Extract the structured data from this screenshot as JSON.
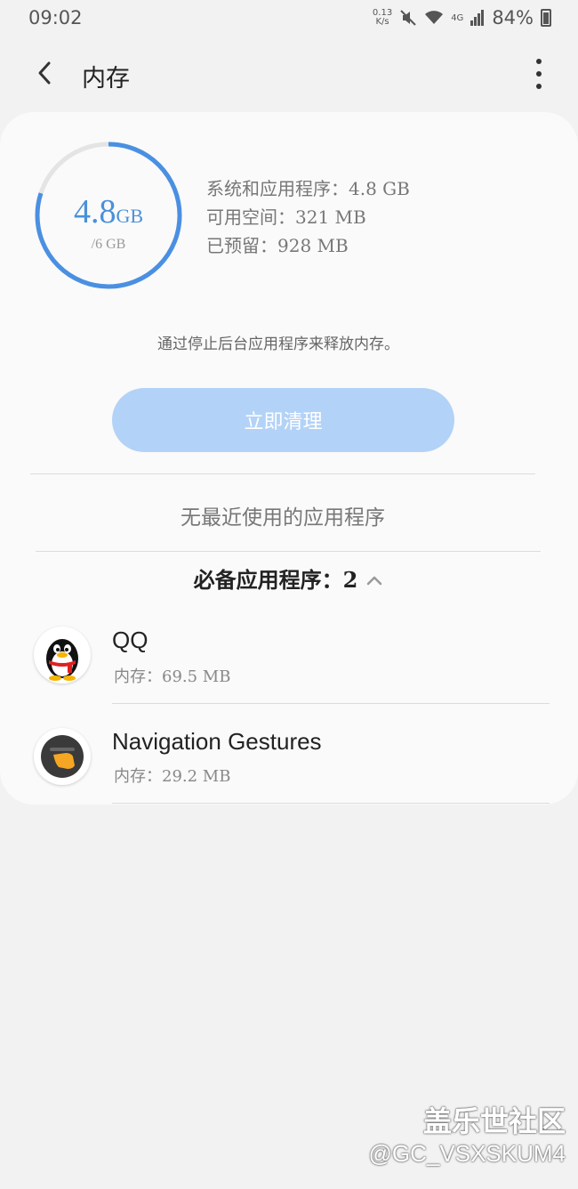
{
  "status_bar": {
    "time": "09:02",
    "net_speed_value": "0.13",
    "net_speed_unit": "K/s",
    "signal_type": "4G",
    "battery": "84%"
  },
  "app_bar": {
    "title": "内存"
  },
  "memory": {
    "used_value": "4.8",
    "used_unit": "GB",
    "total": "/6 GB",
    "used_fraction": 0.8,
    "system_apps": "系统和应用程序：4.8 GB",
    "available": "可用空间：321 MB",
    "reserved": "已预留：928 MB",
    "accent_color": "#4a90e2"
  },
  "hint_text": "通过停止后台应用程序来释放内存。",
  "clean_button": "立即清理",
  "no_recent_text": "无最近使用的应用程序",
  "essential_apps": {
    "title": "必备应用程序：2",
    "items": [
      {
        "name": "QQ",
        "memory": "内存：69.5 MB",
        "icon": "qq-icon"
      },
      {
        "name": "Navigation Gestures",
        "memory": "内存：29.2 MB",
        "icon": "navigation-gestures-icon"
      }
    ]
  },
  "watermark": {
    "main": "盖乐世社区",
    "sub": "@GC_VSXSKUM4"
  }
}
